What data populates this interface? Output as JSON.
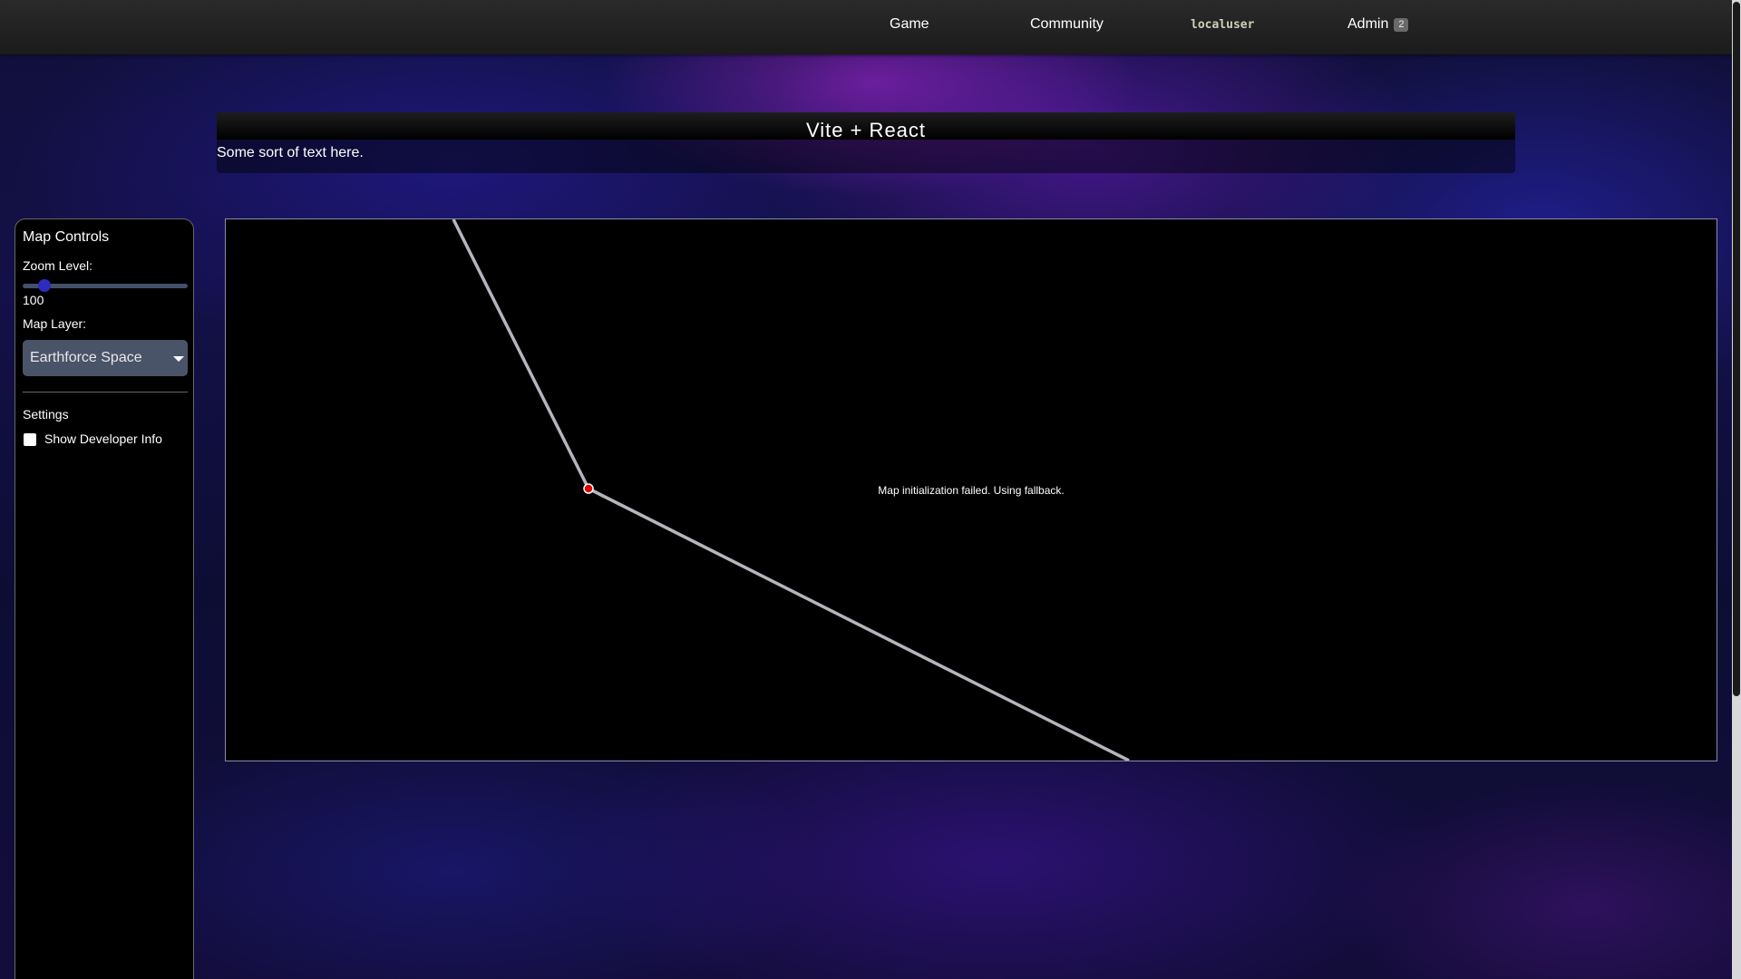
{
  "nav": {
    "game": "Game",
    "community": "Community",
    "user": "localuser",
    "admin": "Admin",
    "admin_badge": "2"
  },
  "header": {
    "title": "Vite + React",
    "subtitle": "Some sort of text here."
  },
  "sidebar": {
    "title": "Map Controls",
    "zoom_label": "Zoom Level:",
    "zoom_value": "100",
    "zoom_fraction": 0.13,
    "layer_label": "Map Layer:",
    "layer_selected": "Earthforce Space",
    "settings_label": "Settings",
    "dev_info_label": "Show Developer Info",
    "dev_info_checked": false
  },
  "map": {
    "message": "Map initialization failed. Using fallback.",
    "route_color": "#b5b5bd",
    "waypoint_color": "#e00000"
  },
  "colors": {
    "slider_thumb": "#2c2cc0",
    "select_bg": "#4a5468"
  }
}
